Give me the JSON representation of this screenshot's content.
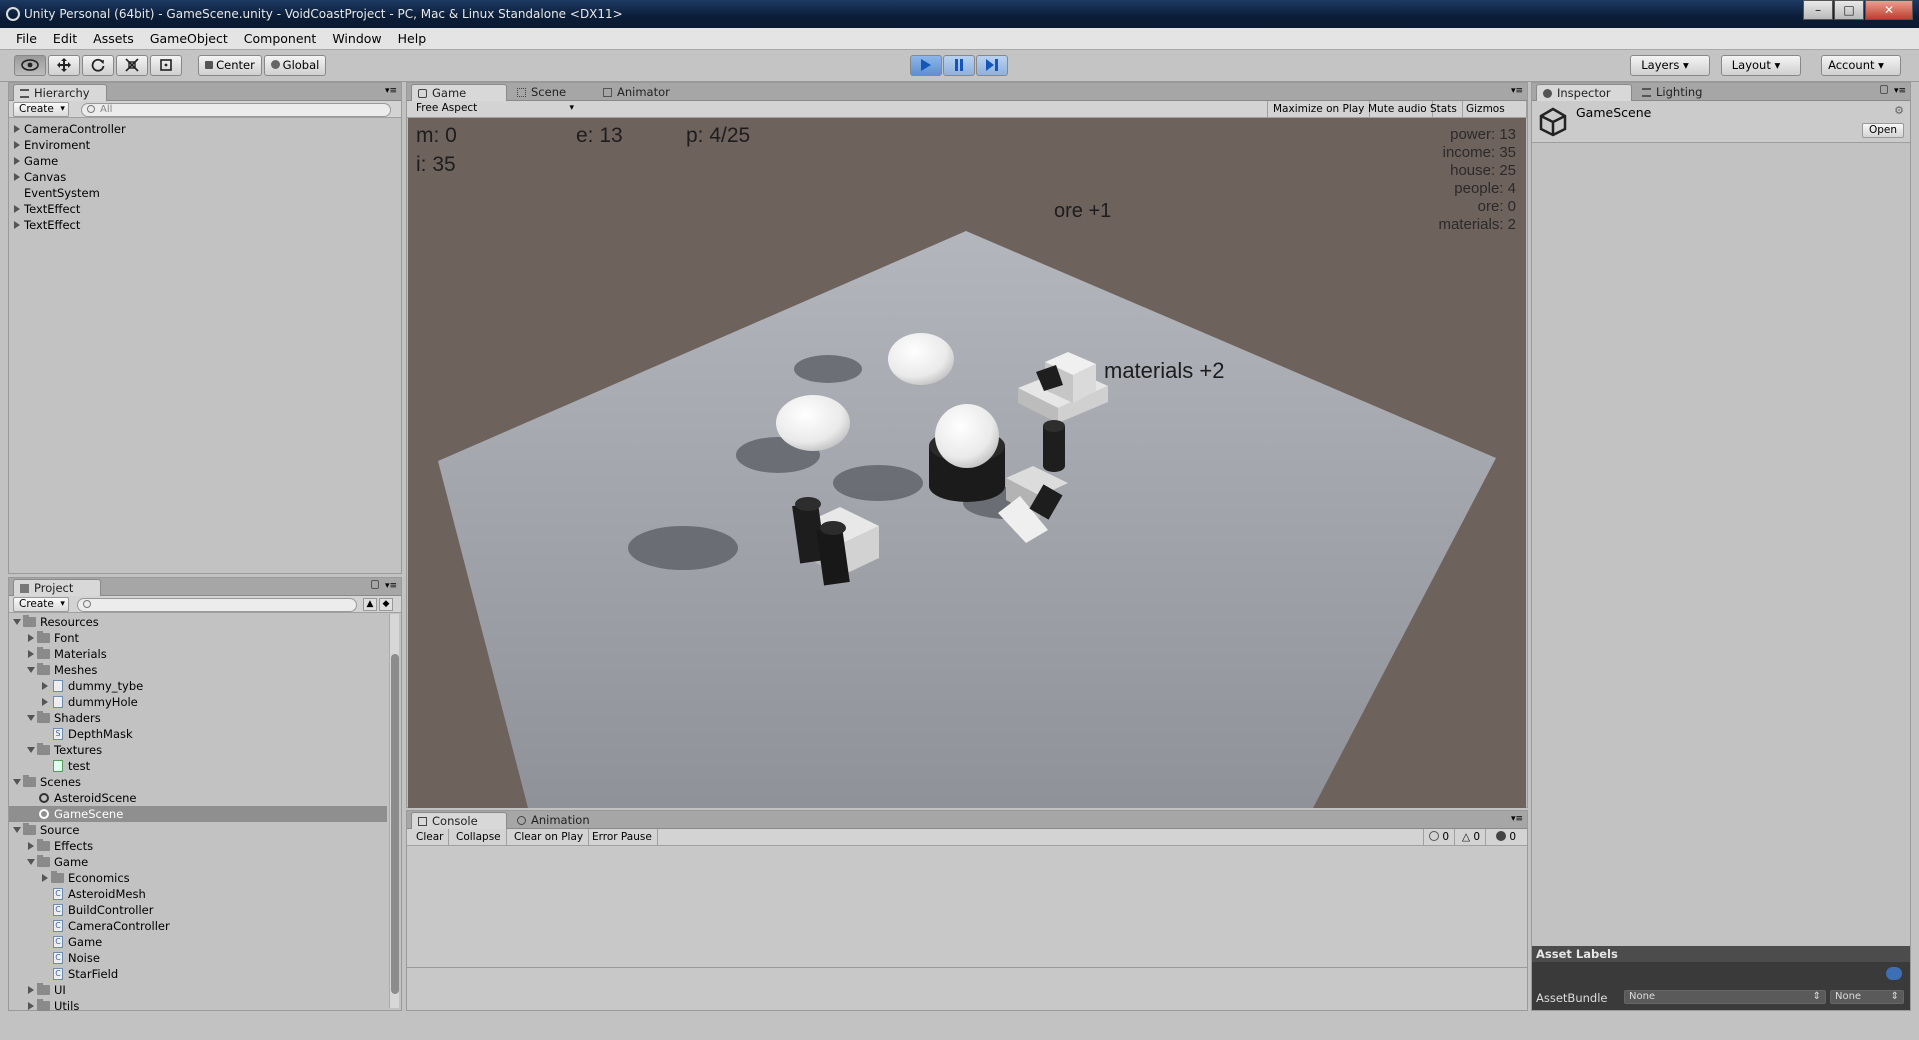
{
  "window": {
    "title": "Unity Personal (64bit) - GameScene.unity - VoidCoastProject - PC, Mac & Linux Standalone <DX11>"
  },
  "menu": [
    "File",
    "Edit",
    "Assets",
    "GameObject",
    "Component",
    "Window",
    "Help"
  ],
  "toolbar": {
    "pivot": "Center",
    "space": "Global",
    "layers": "Layers",
    "layout": "Layout",
    "account": "Account"
  },
  "hierarchy": {
    "tab": "Hierarchy",
    "create": "Create",
    "search_placeholder": "All",
    "items": [
      "CameraController",
      "Enviroment",
      "Game",
      "Canvas",
      "EventSystem",
      "TextEffect",
      "TextEffect"
    ]
  },
  "project": {
    "tab": "Project",
    "create": "Create",
    "tree": [
      "Resources",
      "Font",
      "Materials",
      "Meshes",
      "dummy_tybe",
      "dummyHole",
      "Shaders",
      "DepthMask",
      "Textures",
      "test",
      "Scenes",
      "AsteroidScene",
      "GameScene",
      "Source",
      "Effects",
      "Game",
      "Economics",
      "AsteroidMesh",
      "BuildController",
      "CameraController",
      "Game",
      "Noise",
      "StarField",
      "UI",
      "Utils"
    ]
  },
  "center": {
    "tabs": [
      "Game",
      "Scene",
      "Animator"
    ],
    "aspect": "Free Aspect",
    "options": [
      "Maximize on Play",
      "Mute audio",
      "Stats",
      "Gizmos"
    ]
  },
  "game_hud": {
    "m": "m: 0",
    "e": "e: 13",
    "p": "p: 4/25",
    "i": "i: 35",
    "stats": [
      "power: 13",
      "income: 35",
      "house: 25",
      "people: 4",
      "ore: 0",
      "materials: 2"
    ],
    "float_ore": "ore +1",
    "float_materials": "materials +2"
  },
  "console": {
    "tabs": [
      "Console",
      "Animation"
    ],
    "buttons": [
      "Clear",
      "Collapse",
      "Clear on Play",
      "Error Pause"
    ],
    "counts": [
      "0",
      "0",
      "0"
    ]
  },
  "inspector": {
    "tabs": [
      "Inspector",
      "Lighting"
    ],
    "object": "GameScene",
    "open": "Open",
    "asset_labels": "Asset Labels",
    "asset_bundle": "AssetBundle",
    "bundle_value": "None",
    "variant_value": "None"
  }
}
